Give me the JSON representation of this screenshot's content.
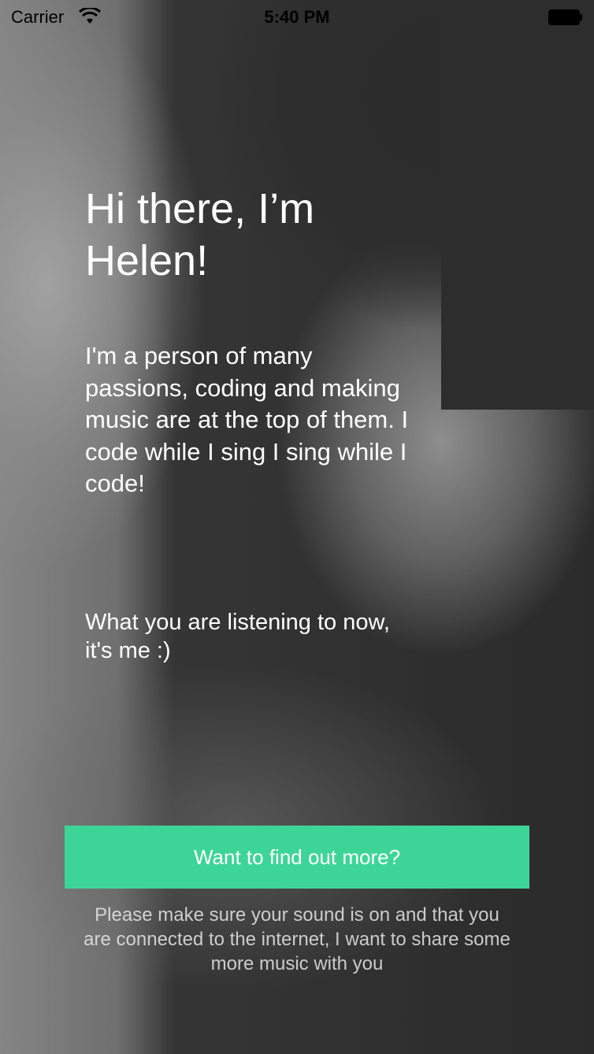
{
  "status_bar": {
    "carrier": "Carrier",
    "time": "5:40 PM"
  },
  "main": {
    "title_line1": "Hi there, I’m",
    "title_line2": "Helen!",
    "bio": "I'm a person of many passions, coding and making music are at the top of them. I code while I sing I sing while I code!",
    "listening_line1": "What you are listening to now,",
    "listening_line2": "it's me :)"
  },
  "cta": {
    "label": "Want to find out more?",
    "color": "#3dd597"
  },
  "footer": {
    "note": "Please make sure your sound is on and that you are connected to the internet, I want to share some more music with you"
  },
  "icons": {
    "wifi": "wifi-icon",
    "battery": "battery-icon"
  }
}
